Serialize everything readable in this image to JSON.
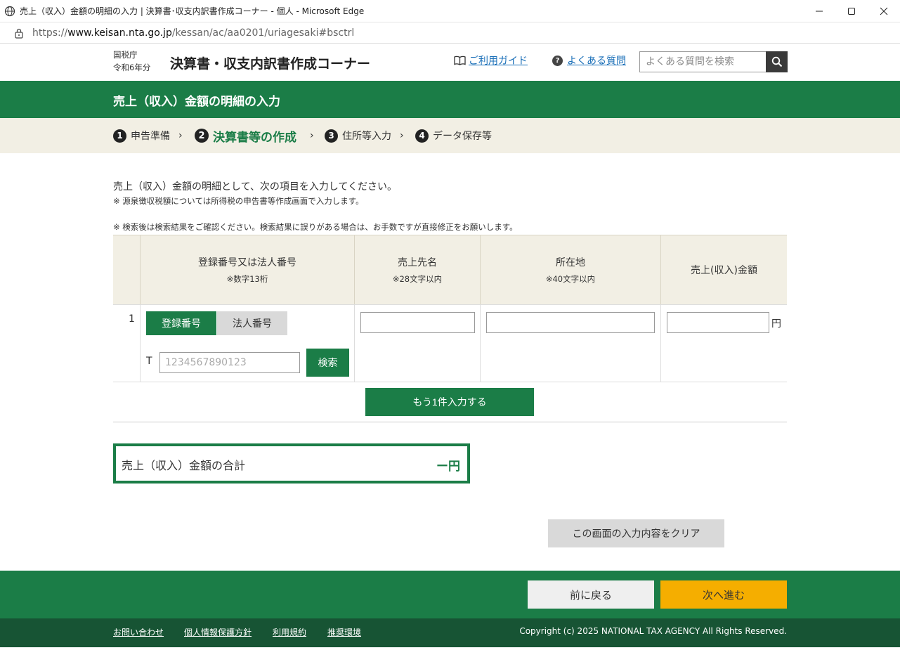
{
  "window": {
    "title": "売上（収入）金額の明細の入力 | 決算書･収支内訳書作成コーナー - 個人 - Microsoft Edge",
    "url_scheme": "https://",
    "url_host": "www.keisan.nta.go.jp",
    "url_path": "/kessan/ac/aa0201/uriagesaki#bsctrl"
  },
  "header": {
    "agency": "国税庁",
    "year": "令和6年分",
    "title": "決算書・収支内訳書作成コーナー",
    "guide_link": "ご利用ガイド",
    "faq_link": "よくある質問",
    "search_placeholder": "よくある質問を検索"
  },
  "page_title": "売上（収入）金額の明細の入力",
  "steps": [
    {
      "num": "1",
      "label": "申告準備"
    },
    {
      "num": "2",
      "label": "決算書等の作成"
    },
    {
      "num": "3",
      "label": "住所等入力"
    },
    {
      "num": "4",
      "label": "データ保存等"
    }
  ],
  "intro": "売上（収入）金額の明細として、次の項目を入力してください。",
  "note_withholding": "※ 源泉徴収税額については所得税の申告書等作成画面で入力します。",
  "note_search": "※ 検索後は検索結果をご確認ください。検索結果に誤りがある場合は、お手数ですが直接修正をお願いします。",
  "table": {
    "col_number": {
      "label": "登録番号又は法人番号",
      "sub": "※数字13桁"
    },
    "col_name": {
      "label": "売上先名",
      "sub": "※28文字以内"
    },
    "col_address": {
      "label": "所在地",
      "sub": "※40文字以内"
    },
    "col_amount": {
      "label": "売上(収入)金額"
    },
    "rows": [
      {
        "index": "1",
        "tab_registration": "登録番号",
        "tab_corporate": "法人番号",
        "prefix": "T",
        "number_placeholder": "1234567890123",
        "search_button": "検索",
        "name": "",
        "address": "",
        "amount": "",
        "unit": "円"
      }
    ]
  },
  "add_row_button": "もう1件入力する",
  "total": {
    "label": "売上（収入）金額の合計",
    "value": "ー円"
  },
  "clear_button": "この画面の入力内容をクリア",
  "back_button": "前に戻る",
  "next_button": "次へ進む",
  "footer": {
    "links": [
      "お問い合わせ",
      "個人情報保護方針",
      "利用規約",
      "推奨環境"
    ],
    "copyright": "Copyright (c) 2025 NATIONAL TAX AGENCY All Rights Reserved."
  },
  "colors": {
    "brand_green": "#1b7d47",
    "footer_green": "#175434",
    "next_yellow": "#f5ae00",
    "steps_bg": "#f2efe4"
  }
}
